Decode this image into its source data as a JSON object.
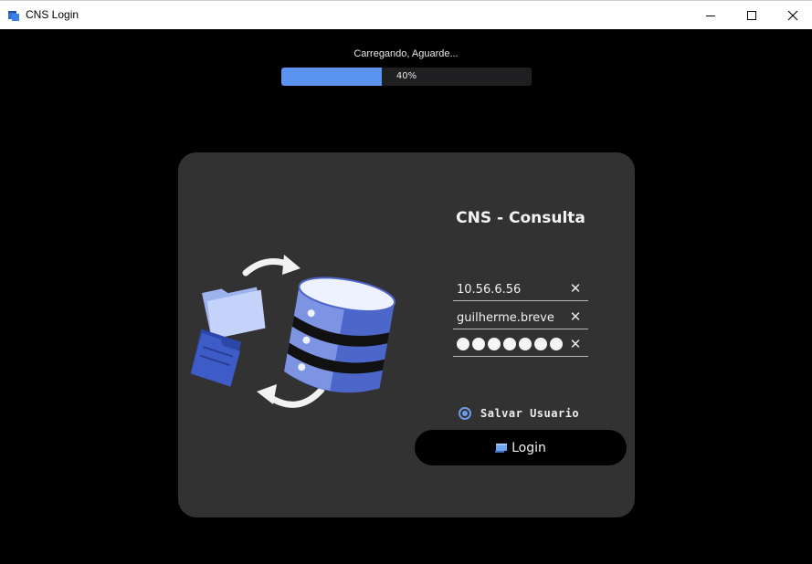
{
  "window": {
    "title": "CNS Login",
    "app_icon": "app-window-icon",
    "controls": [
      "minimize-icon",
      "maximize-icon",
      "close-icon"
    ]
  },
  "progress": {
    "label": "Carregando, Aguarde...",
    "value_percent": 40,
    "value_text": "40%",
    "fill_color": "#5b93f1"
  },
  "login": {
    "title": "CNS - Consulta",
    "illustration": "database-folders-sync-illustration",
    "fields": {
      "server": {
        "value": "10.56.6.56",
        "clear_icon": "✕"
      },
      "username": {
        "value": "guilherme.breve",
        "clear_icon": "✕"
      },
      "password": {
        "masked_dots": 7,
        "clear_icon": "✕"
      }
    },
    "remember_label": "Salvar Usuario",
    "remember_checked": true,
    "button_label": "Login",
    "button_icon": "login-icon"
  },
  "colors": {
    "background": "#000000",
    "panel": "#323232",
    "accent": "#5b93f1"
  }
}
